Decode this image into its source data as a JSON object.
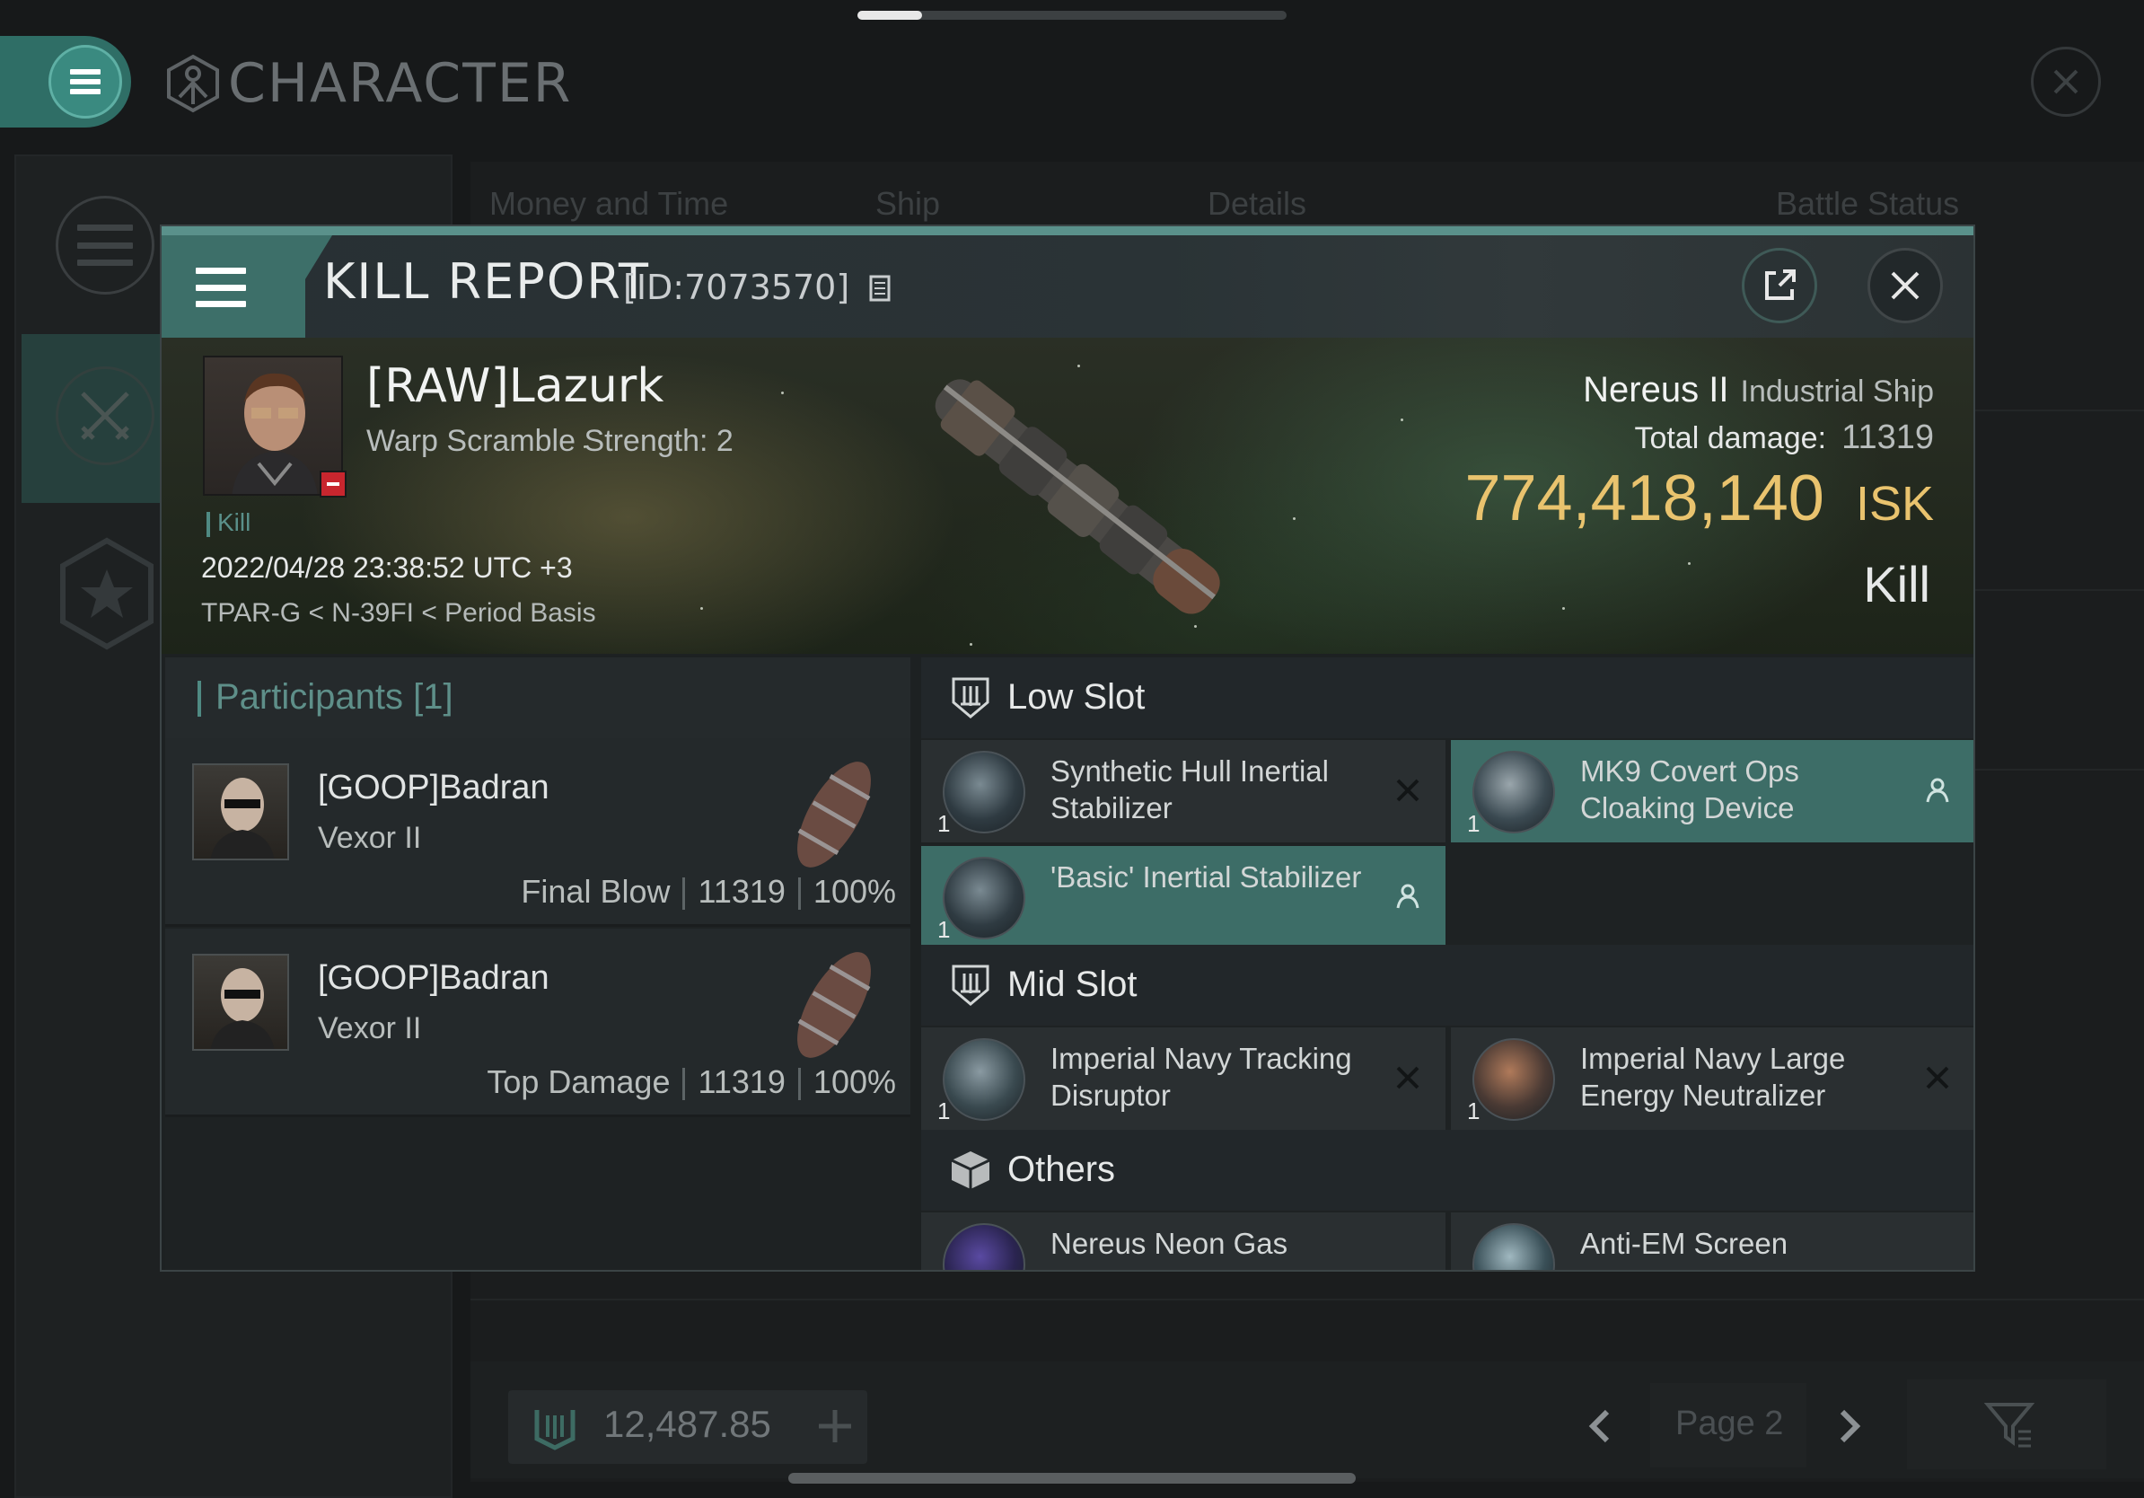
{
  "app": {
    "title": "CHARACTER",
    "background_tabs": [
      "Money and Time",
      "Ship",
      "Details",
      "Battle Status"
    ],
    "wallet_value": "12,487.85",
    "page_label": "Page 2",
    "scroll_progress": 0.15
  },
  "kill_report": {
    "title": "KILL REPORT",
    "id_label": "[ID:7073570]",
    "victim": {
      "name": "[RAW]Lazurk",
      "subtitle": "Warp Scramble Strength: 2",
      "tag": "Kill",
      "timestamp": "2022/04/28 23:38:52 UTC +3",
      "location": "TPAR-G < N-39FI < Period Basis"
    },
    "ship": {
      "name": "Nereus II",
      "class": "Industrial Ship",
      "damage_label": "Total damage:",
      "damage_value": "11319",
      "isk_value": "774,418,140",
      "isk_unit": "ISK",
      "result": "Kill"
    },
    "participants": {
      "title": "Participants [1]",
      "items": [
        {
          "name": "[GOOP]Badran",
          "ship": "Vexor II",
          "role": "Final Blow",
          "damage": "11319",
          "percent": "100%"
        },
        {
          "name": "[GOOP]Badran",
          "ship": "Vexor II",
          "role": "Top Damage",
          "damage": "11319",
          "percent": "100%"
        }
      ]
    },
    "sections": {
      "low_slot": {
        "label": "Low Slot",
        "modules": [
          {
            "name": "Synthetic Hull Inertial Stabilizer",
            "qty": "1",
            "status": "destroyed"
          },
          {
            "name": "MK9 Covert Ops Cloaking Device",
            "qty": "1",
            "status": "dropped"
          },
          {
            "name": "'Basic' Inertial Stabilizer",
            "qty": "1",
            "status": "dropped"
          }
        ]
      },
      "mid_slot": {
        "label": "Mid Slot",
        "modules": [
          {
            "name": "Imperial Navy Tracking Disruptor",
            "qty": "1",
            "status": "destroyed"
          },
          {
            "name": "Imperial Navy Large Energy Neutralizer",
            "qty": "1",
            "status": "destroyed"
          }
        ]
      },
      "others": {
        "label": "Others",
        "modules": [
          {
            "name": "Nereus Neon Gas",
            "status": "destroyed"
          },
          {
            "name": "Anti-EM Screen",
            "status": "destroyed"
          }
        ]
      }
    }
  },
  "colors": {
    "accent": "#3d6d67",
    "isk": "#e9c36e",
    "destroyed_mark": "#121516",
    "minus_badge": "#c8262e"
  },
  "icons": [
    "menu-icon",
    "character-icon",
    "close-icon",
    "share-icon",
    "wallet-icon",
    "plus-icon",
    "chevron-left-icon",
    "chevron-right-icon",
    "filter-icon",
    "low-slot-icon",
    "mid-slot-icon",
    "cargo-box-icon",
    "person-icon"
  ]
}
